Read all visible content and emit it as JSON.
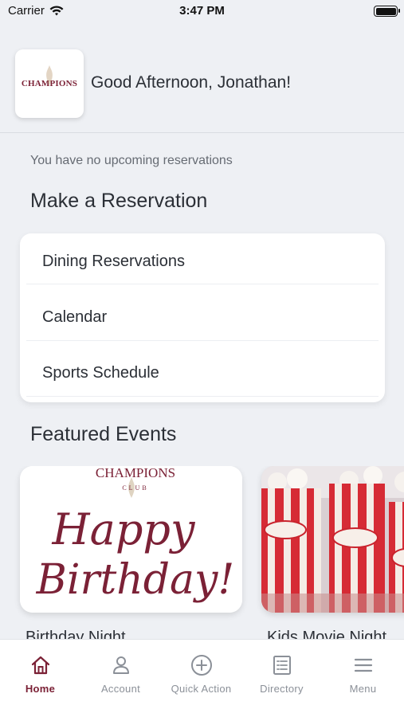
{
  "status_bar": {
    "carrier": "Carrier",
    "time": "3:47 PM",
    "battery_level": 1.0
  },
  "header": {
    "logo_text": "CHAMPIONS",
    "greeting": "Good Afternoon, Jonathan!"
  },
  "reservations": {
    "empty_message": "You have no upcoming reservations",
    "section_title": "Make a Reservation",
    "items": [
      {
        "label": "Dining Reservations"
      },
      {
        "label": "Calendar"
      },
      {
        "label": "Sports Schedule"
      }
    ]
  },
  "featured": {
    "section_title": "Featured Events",
    "events": [
      {
        "name": "Birthday Night",
        "image_logo": "CHAMPIONS",
        "image_logo_sub": "CLUB",
        "image_script_line1": "Happy",
        "image_script_line2": "Birthday!"
      },
      {
        "name": "Kids Movie Night",
        "image_icon": "popcorn-image"
      }
    ]
  },
  "tab_bar": {
    "tabs": [
      {
        "label": "Home",
        "icon": "home-icon",
        "active": true
      },
      {
        "label": "Account",
        "icon": "person-icon",
        "active": false
      },
      {
        "label": "Quick Action",
        "icon": "plus-circle-icon",
        "active": false
      },
      {
        "label": "Directory",
        "icon": "directory-icon",
        "active": false
      },
      {
        "label": "Menu",
        "icon": "hamburger-menu-icon",
        "active": false
      }
    ]
  },
  "colors": {
    "brand": "#7b2136",
    "background": "#eef0f4",
    "text": "#2b2f36",
    "muted": "#8b9098"
  }
}
